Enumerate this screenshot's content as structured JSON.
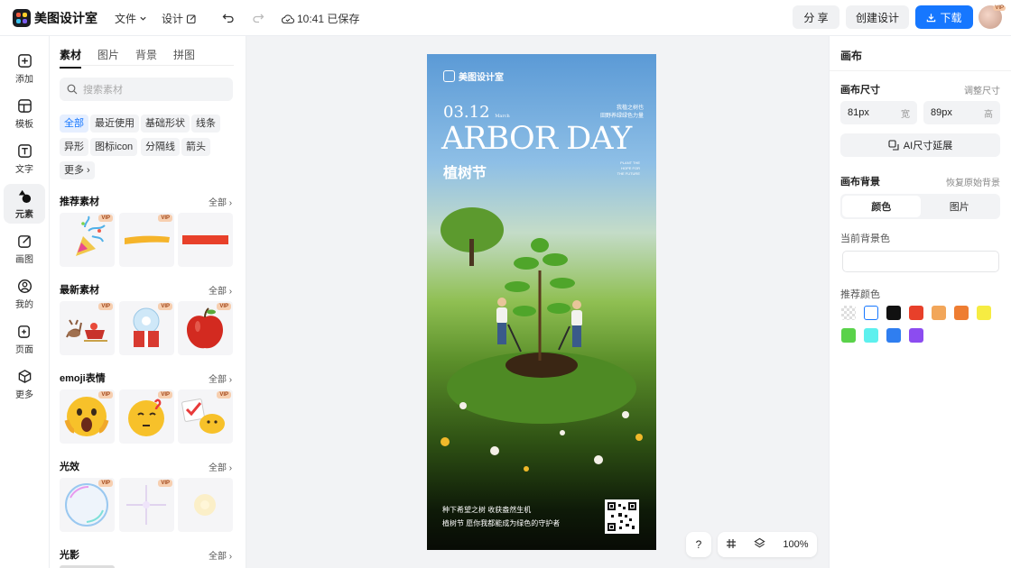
{
  "app": {
    "name": "美图设计室"
  },
  "topbar": {
    "file_menu": "文件",
    "design_menu": "设计",
    "save_status": "10:41 已保存",
    "share_label": "分 享",
    "create_label": "创建设计",
    "download_label": "下载",
    "avatar_badge": "VIP"
  },
  "leftnav": {
    "items": [
      {
        "label": "添加",
        "icon": "plus-square-icon"
      },
      {
        "label": "模板",
        "icon": "template-icon"
      },
      {
        "label": "文字",
        "icon": "text-icon"
      },
      {
        "label": "元素",
        "icon": "shapes-icon"
      },
      {
        "label": "画图",
        "icon": "draw-icon"
      },
      {
        "label": "我的",
        "icon": "user-icon"
      },
      {
        "label": "页面",
        "icon": "page-add-icon"
      },
      {
        "label": "更多",
        "icon": "cube-icon"
      }
    ]
  },
  "panel": {
    "tabs": [
      "素材",
      "图片",
      "背景",
      "拼图"
    ],
    "search_placeholder": "搜索素材",
    "chips": [
      "全部",
      "最近使用",
      "基础形状",
      "线条",
      "异形",
      "图标icon",
      "分隔线",
      "箭头",
      "更多"
    ],
    "all_label": "全部",
    "vip_label": "VIP",
    "sections": [
      "推荐素材",
      "最新素材",
      "emoji表情",
      "光效",
      "光影"
    ]
  },
  "poster": {
    "brand": "美图设计室",
    "date": "03.12",
    "date_suffix": "March",
    "title": "ARBOR DAY",
    "cn_title": "植树节",
    "right_line1": "我植之树也",
    "right_line2": "田野养绿绿色力量",
    "right_small1": "PLANT THE",
    "right_small2": "HOPE FOR",
    "right_small3": "THE FUTURE",
    "bottom_line1": "种下希望之树 收获盎然生机",
    "bottom_line2": "植树节 愿你我都能成为绿色的守护者"
  },
  "zoom": {
    "help": "?",
    "level": "100%"
  },
  "rpanel": {
    "title": "画布",
    "size_label": "画布尺寸",
    "resize_link": "调整尺寸",
    "width_value": "81px",
    "width_unit": "宽",
    "height_value": "89px",
    "height_unit": "高",
    "ai_extend": "AI尺寸延展",
    "bg_label": "画布背景",
    "restore_link": "恢复原始背景",
    "seg_color": "颜色",
    "seg_image": "图片",
    "current_bg": "当前背景色",
    "recommended": "推荐颜色",
    "swatches": [
      "transparent",
      "#ffffff",
      "#111111",
      "#e8402a",
      "#f2a65a",
      "#ee7d32",
      "#f6ec42",
      "#5ad24a",
      "#5df0ee",
      "#2f7ef0",
      "#8c4cf0"
    ]
  },
  "colors": {
    "accent": "#1677ff"
  }
}
